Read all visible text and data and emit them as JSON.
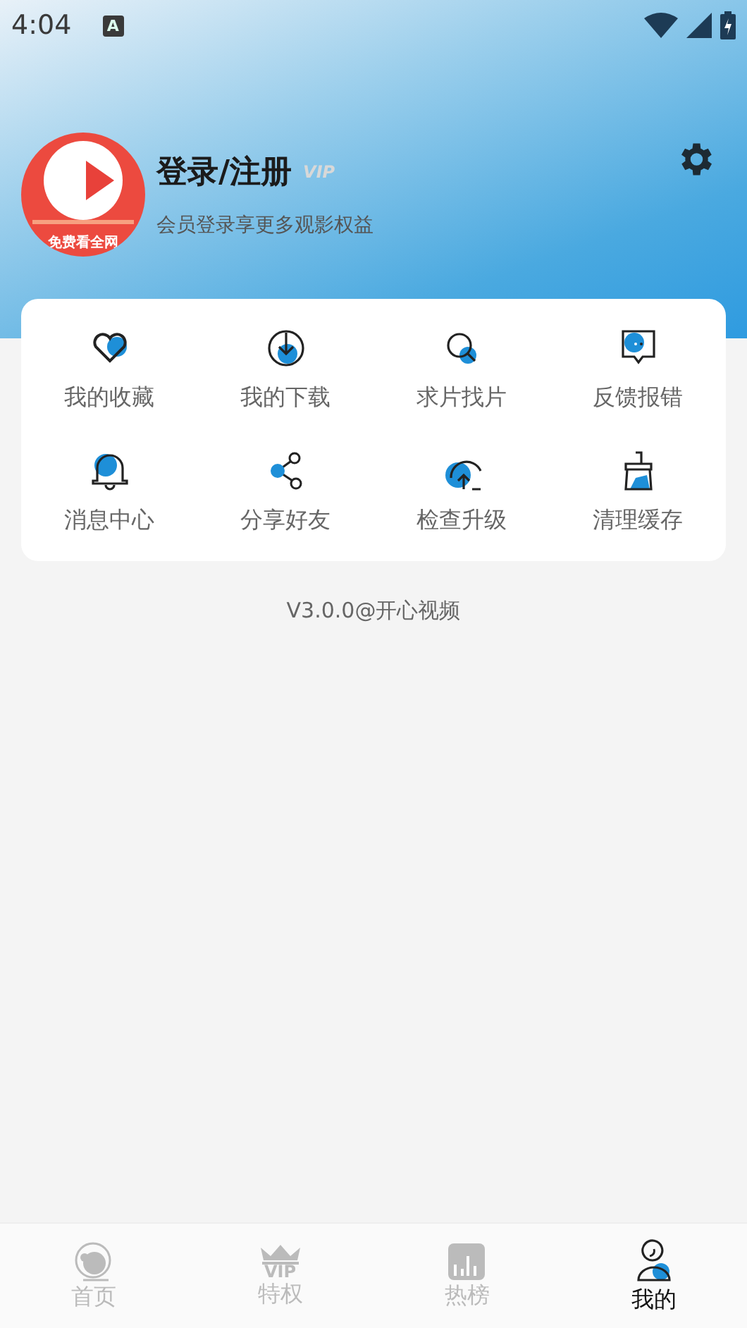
{
  "status_bar": {
    "time": "4:04",
    "notification": "A"
  },
  "profile": {
    "logo_caption": "免费看全网",
    "title": "登录/注册",
    "vip_badge": "VIP",
    "subtitle": "会员登录享更多观影权益"
  },
  "menu": [
    {
      "kind": "heart",
      "label": "我的收藏"
    },
    {
      "kind": "download",
      "label": "我的下载"
    },
    {
      "kind": "search",
      "label": "求片找片"
    },
    {
      "kind": "feedback",
      "label": "反馈报错"
    },
    {
      "kind": "bell",
      "label": "消息中心"
    },
    {
      "kind": "share",
      "label": "分享好友"
    },
    {
      "kind": "upgrade",
      "label": "检查升级"
    },
    {
      "kind": "broom",
      "label": "清理缓存"
    }
  ],
  "version": "V3.0.0@开心视频",
  "tabs": [
    {
      "kind": "home",
      "label": "首页",
      "selected": false
    },
    {
      "kind": "vip",
      "label": "特权",
      "icon_text": "VIP",
      "selected": false
    },
    {
      "kind": "chart",
      "label": "热榜",
      "selected": false
    },
    {
      "kind": "me",
      "label": "我的",
      "selected": true
    }
  ]
}
